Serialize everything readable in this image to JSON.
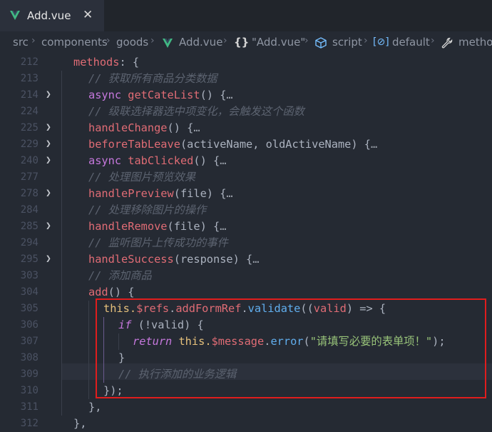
{
  "tab": {
    "label": "Add.vue",
    "close": "✕"
  },
  "breadcrumb": {
    "items": [
      "src",
      "components",
      "goods",
      "Add.vue",
      "\"Add.vue\"",
      "script",
      "default",
      "metho"
    ],
    "icons": [
      "vue-icon",
      "braces-icon",
      "cube-icon",
      "bracket-icon",
      "wrench-icon"
    ]
  },
  "editor": {
    "line_numbers": [
      "212",
      "213",
      "214",
      "224",
      "225",
      "229",
      "240",
      "277",
      "278",
      "284",
      "285",
      "294",
      "295",
      "303",
      "304",
      "305",
      "306",
      "307",
      "308",
      "309",
      "310",
      "311",
      "312"
    ],
    "lines": {
      "l212": {
        "name": "methods",
        "rest": ": {"
      },
      "l213": {
        "comment": "// 获取所有商品分类数据"
      },
      "l214": {
        "kw": "async ",
        "fn": "getCateList",
        "rest": "() {"
      },
      "l224": {
        "comment": "// 级联选择器选中项变化，会触发这个函数"
      },
      "l225": {
        "fn": "handleChange",
        "rest": "() {"
      },
      "l229": {
        "fn": "beforeTabLeave",
        "rest": "(activeName, oldActiveName) {"
      },
      "l240": {
        "kw": "async ",
        "fn": "tabClicked",
        "rest": "() {"
      },
      "l277": {
        "comment": "// 处理图片预览效果"
      },
      "l278": {
        "fn": "handlePreview",
        "rest": "(file) {"
      },
      "l284": {
        "comment": "// 处理移除图片的操作"
      },
      "l285": {
        "fn": "handleRemove",
        "rest": "(file) {"
      },
      "l294": {
        "comment": "// 监听图片上传成功的事件"
      },
      "l295": {
        "fn": "handleSuccess",
        "rest": "(response) {"
      },
      "l303": {
        "comment": "// 添加商品"
      },
      "l304": {
        "fn": "add",
        "rest": "() {"
      },
      "l305": {
        "this": "this.",
        "refs": "$refs",
        "dot1": ".",
        "formref": "addFormRef",
        "dot2": ".",
        "validate": "validate",
        "open": "((",
        "param": "valid",
        "arrow": ") => {"
      },
      "l306": {
        "kw": "if",
        "rest": " (!valid) {"
      },
      "l307": {
        "kw": "return",
        "this": " this.",
        "msg": "$message",
        "dot": ".",
        "err": "error",
        "open": "(",
        "str": "\"请填写必要的表单项！\"",
        "close": ");"
      },
      "l308": {
        "text": "}"
      },
      "l309": {
        "comment": "// 执行添加的业务逻辑"
      },
      "l310": {
        "text": "});"
      },
      "l311": {
        "text": "},"
      },
      "l312": {
        "text": "},"
      }
    },
    "ellipsis": "…",
    "fold_icon": "chevron-right-icon"
  },
  "colors": {
    "background": "#252a33",
    "keyword": "#c678dd",
    "function": "#e06c75",
    "method": "#61afef",
    "string": "#98c379",
    "comment": "#5c6370",
    "highlight_border": "#e01d1d",
    "vue_green": "#41b883"
  }
}
